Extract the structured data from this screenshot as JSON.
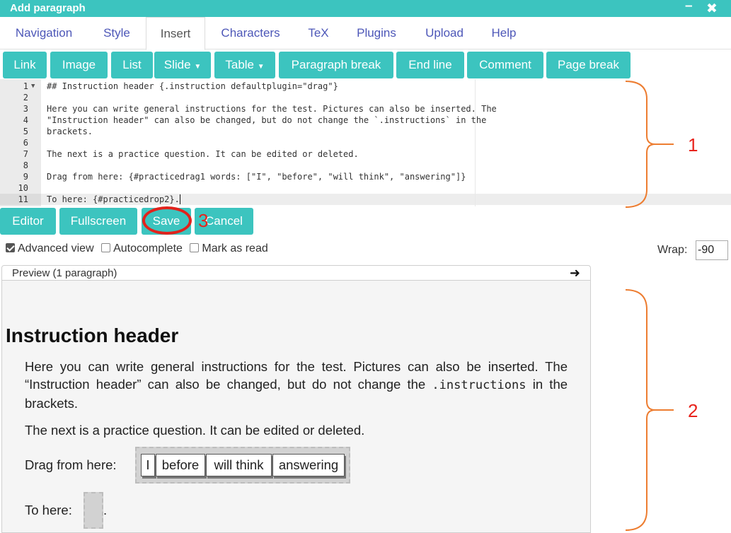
{
  "window": {
    "title": "Add paragraph",
    "minimize_icon": "minimize-icon",
    "close_icon": "close-icon"
  },
  "menu": {
    "tabs": [
      {
        "label": "Navigation"
      },
      {
        "label": "Style"
      },
      {
        "label": "Insert",
        "active": true
      },
      {
        "label": "Characters"
      },
      {
        "label": "TeX"
      },
      {
        "label": "Plugins"
      },
      {
        "label": "Upload"
      },
      {
        "label": "Help"
      }
    ]
  },
  "toolbar": {
    "buttons": [
      {
        "label": "Link"
      },
      {
        "label": "Image"
      },
      {
        "label": "List"
      },
      {
        "label": "Slide",
        "dropdown": true
      },
      {
        "label": "Table",
        "dropdown": true
      },
      {
        "label": "Paragraph break"
      },
      {
        "label": "End line"
      },
      {
        "label": "Comment"
      },
      {
        "label": "Page break"
      }
    ]
  },
  "editor": {
    "lines": [
      {
        "n": "1",
        "text": "## Instruction header {.instruction defaultplugin=\"drag\"}"
      },
      {
        "n": "2",
        "text": ""
      },
      {
        "n": "3",
        "text": "Here you can write general instructions for the test. Pictures can also be inserted. The"
      },
      {
        "n": "4",
        "text": "\"Instruction header\" can also be changed, but do not change the `.instructions` in the"
      },
      {
        "n": "5",
        "text": "brackets."
      },
      {
        "n": "6",
        "text": ""
      },
      {
        "n": "7",
        "text": "The next is a practice question. It can be edited or deleted."
      },
      {
        "n": "8",
        "text": ""
      },
      {
        "n": "9",
        "text": "Drag from here: {#practicedrag1 words: [\"I\", \"before\", \"will think\", \"answering\"]}"
      },
      {
        "n": "10",
        "text": ""
      },
      {
        "n": "11",
        "text": "To here: {#practicedrop2}."
      }
    ]
  },
  "actions": {
    "editor": "Editor",
    "fullscreen": "Fullscreen",
    "save": "Save",
    "cancel": "Cancel"
  },
  "options": {
    "advanced_view": "Advanced view",
    "autocomplete": "Autocomplete",
    "mark_as_read": "Mark as read",
    "advanced_checked": true
  },
  "wrap": {
    "label": "Wrap:",
    "value": "-90"
  },
  "preview": {
    "header": "Preview (1 paragraph)",
    "heading": "Instruction header",
    "para1_a": "Here you can write general instructions for the test. Pictures can also be inserted. The “Instruction header” can also be changed, but do not change the",
    "para1_code": ".instructions",
    "para1_b": "in the brackets.",
    "para2": "The next is a practice question. It can be edited or deleted.",
    "drag_label": "Drag from here:",
    "words": [
      "I",
      "before",
      "will think",
      "answering"
    ],
    "drop_label": "To here:",
    "drop_tail": "."
  },
  "annotations": {
    "label1": "1",
    "label2": "2",
    "label3": "3"
  },
  "colors": {
    "accent": "#3cc4bf",
    "link": "#4d57b8",
    "annotation_red": "#e2221c",
    "annotation_orange": "#ed7d31"
  }
}
